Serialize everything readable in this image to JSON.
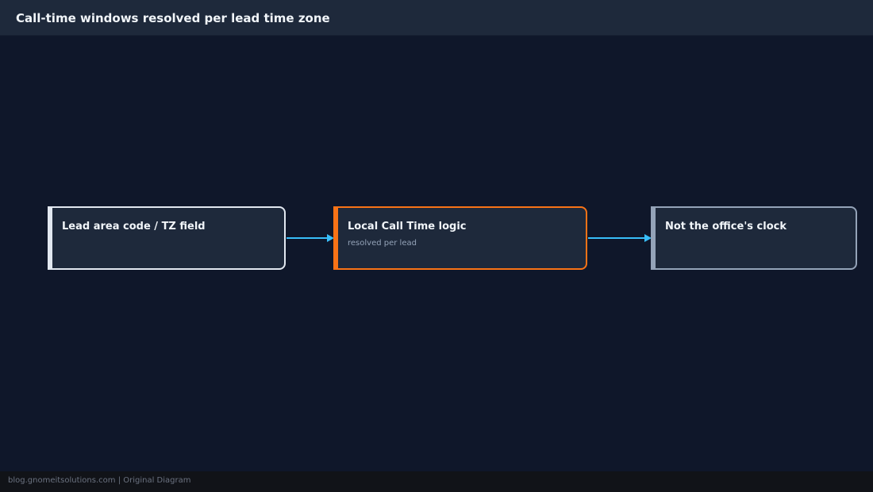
{
  "header": {
    "title": "Call-time windows resolved per lead time zone"
  },
  "nodes": [
    {
      "title": "Lead area code / TZ field",
      "subtitle": ""
    },
    {
      "title": "Local Call Time logic",
      "subtitle": "resolved per lead"
    },
    {
      "title": "Not the office's clock",
      "subtitle": ""
    }
  ],
  "colors": {
    "background": "#0f172a",
    "header": "#1e293b",
    "node_fill": "#1e293b",
    "node_1_border": "#e2e8f0",
    "node_2_border": "#f97316",
    "node_3_border": "#94a3b8",
    "arrow": "#38bdf8"
  },
  "footer": {
    "text": "blog.gnomeitsolutions.com | Original Diagram"
  }
}
